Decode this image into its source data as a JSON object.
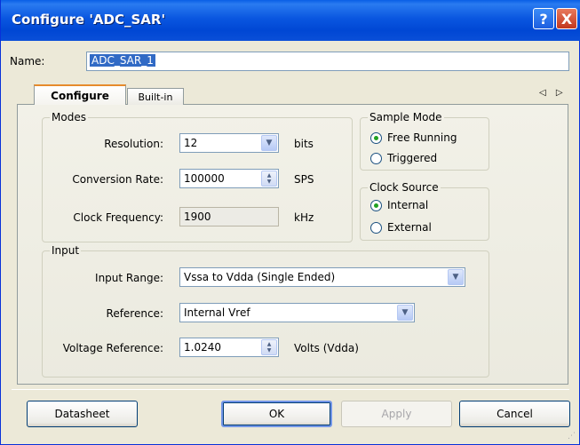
{
  "window": {
    "title": "Configure 'ADC_SAR'",
    "help_glyph": "?",
    "close_glyph": "X"
  },
  "name_field": {
    "label": "Name:",
    "value": "ADC_SAR_1"
  },
  "tabs": [
    {
      "label": "Configure",
      "active": true
    },
    {
      "label": "Built-in",
      "active": false
    }
  ],
  "tab_scroll": "◁ ▷",
  "modes": {
    "legend": "Modes",
    "resolution": {
      "label": "Resolution:",
      "value": "12",
      "unit": "bits"
    },
    "conversion_rate": {
      "label": "Conversion Rate:",
      "value": "100000",
      "unit": "SPS"
    },
    "clock_frequency": {
      "label": "Clock Frequency:",
      "value": "1900",
      "unit": "kHz"
    }
  },
  "sample_mode": {
    "legend": "Sample Mode",
    "options": [
      {
        "label": "Free Running",
        "selected": true
      },
      {
        "label": "Triggered",
        "selected": false
      }
    ]
  },
  "clock_source": {
    "legend": "Clock Source",
    "options": [
      {
        "label": "Internal",
        "selected": true
      },
      {
        "label": "External",
        "selected": false
      }
    ]
  },
  "input": {
    "legend": "Input",
    "input_range": {
      "label": "Input Range:",
      "value": "Vssa to Vdda (Single Ended)"
    },
    "reference": {
      "label": "Reference:",
      "value": "Internal Vref"
    },
    "voltage_reference": {
      "label": "Voltage Reference:",
      "value": "1.0240",
      "unit": "Volts (Vdda)"
    }
  },
  "buttons": {
    "datasheet": "Datasheet",
    "ok": "OK",
    "apply": "Apply",
    "cancel": "Cancel"
  },
  "icons": {
    "dropdown": "chevron-down-icon",
    "spinner": "spinner-arrows-icon",
    "resize_grip": "resize-grip-icon"
  }
}
